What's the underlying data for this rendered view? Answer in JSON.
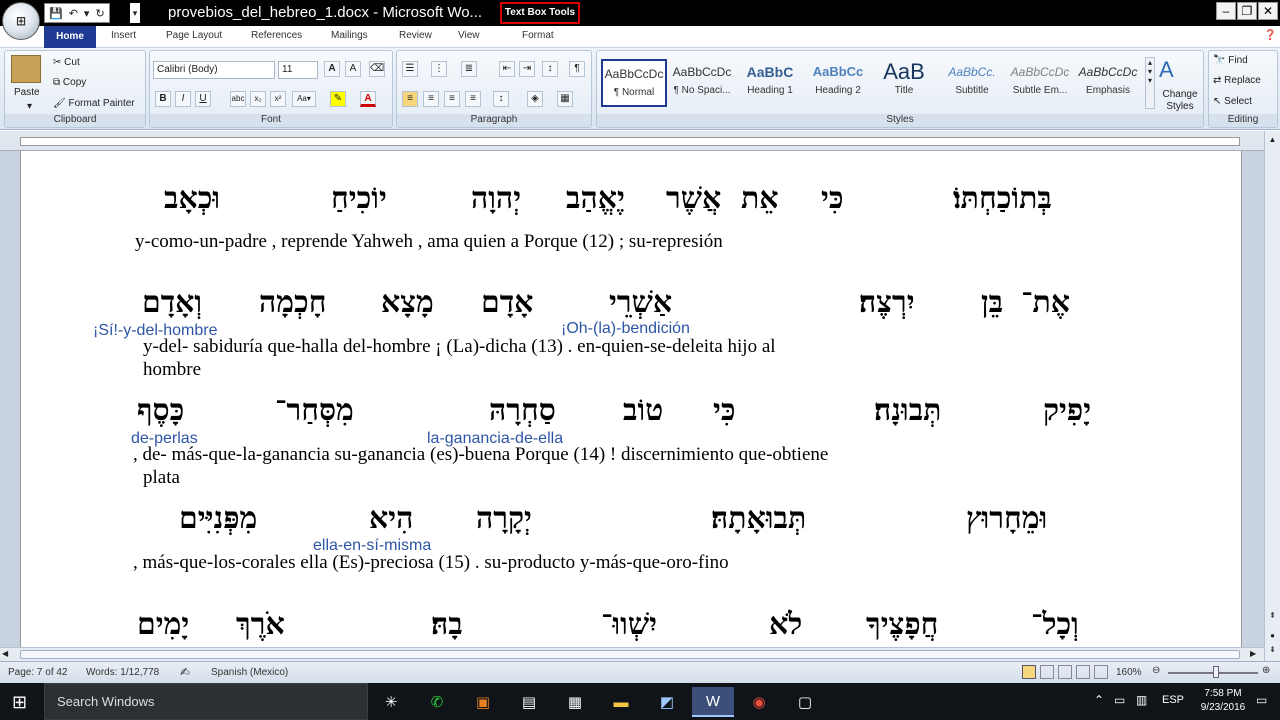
{
  "window": {
    "title": "provebios_del_hebreo_1.docx - Microsoft Wo...",
    "context_tab": "Text Box Tools",
    "office_button": "⊞"
  },
  "tabs": [
    "Home",
    "Insert",
    "Page Layout",
    "References",
    "Mailings",
    "Review",
    "View",
    "Format"
  ],
  "clipboard": {
    "paste": "Paste",
    "cut": "Cut",
    "copy": "Copy",
    "format_painter": "Format Painter",
    "label": "Clipboard"
  },
  "font": {
    "name": "Calibri (Body)",
    "size": "11",
    "label": "Font"
  },
  "paragraph": {
    "label": "Paragraph"
  },
  "styles": {
    "label": "Styles",
    "items": [
      {
        "preview": "AaBbCcDc",
        "name": "¶ Normal"
      },
      {
        "preview": "AaBbCcDc",
        "name": "¶ No Spaci..."
      },
      {
        "preview": "AaBbC",
        "name": "Heading 1"
      },
      {
        "preview": "AaBbCc",
        "name": "Heading 2"
      },
      {
        "preview": "AaB",
        "name": "Title"
      },
      {
        "preview": "AaBbCc.",
        "name": "Subtitle"
      },
      {
        "preview": "AaBbCcDc",
        "name": "Subtle Em..."
      },
      {
        "preview": "AaBbCcDc",
        "name": "Emphasis"
      }
    ],
    "change_styles": "Change Styles"
  },
  "editing": {
    "find": "Find",
    "replace": "Replace",
    "select": "Select",
    "label": "Editing"
  },
  "document": {
    "verses": [
      {
        "hebrew": [
          "בְּתוֹכַחְתּוֹ׃",
          "כִּי",
          "אֵת",
          "אֲשֶׁר",
          "יֶאֱהַב",
          "יְהוָה",
          "יוֹכִיחַ",
          "וּכְאָב"
        ],
        "spanish": "y-como-un-padre   , reprende      Yahweh     , ama       quien     a    Porque   (12)    ; su-represión",
        "comments": []
      },
      {
        "hebrew": [
          "אֶת־",
          "בֵּן",
          "יִרְצֶה׃",
          "אַשְׁרֵי",
          "אָדָם",
          "מָצָא",
          "חָכְמָה",
          "וְאָדָם"
        ],
        "spanish": "y-del-      sabiduría    que-halla   del-hombre   ¡ (La)-dicha    (13)     . en-quien-se-deleita    hijo     al",
        "spanish2": "hombre",
        "comments": [
          "¡Sí!-y-del-hombre",
          "¡Oh-(la)-bendición"
        ]
      },
      {
        "hebrew": [
          "יָפִיק",
          "תְּבוּנָה׃",
          "כִּי",
          "טוֹב",
          "סַחְרָהּ",
          "מִסְּחַר־",
          "כָּסֶף"
        ],
        "spanish": ", de-      más-que-la-ganancia      su-ganancia    (es)-buena   Porque   (14)   ! discernimiento   que-obtiene",
        "spanish2": "plata",
        "comments": [
          "de-perlas",
          "la-ganancia-de-ella"
        ]
      },
      {
        "hebrew": [
          "וּמֵחָרוּץ",
          "תְּבוּאָתָהּ׃",
          "יְקָרָה",
          "הִיא",
          "מִפְּנִיִּים"
        ],
        "spanish": ", más-que-los-corales          ella      (Es)-preciosa         (15)         . su-producto                 y-más-que-oro-fino",
        "comments": [
          "ella-en-sí-misma"
        ]
      },
      {
        "hebrew": [
          "וְכָל־",
          "חֲפָצֶיךָ",
          "לֹא",
          "יִשְׁווּ־",
          "בָהּ׃",
          "אֹרֶךְ",
          "יָמִים"
        ]
      }
    ]
  },
  "status": {
    "page": "Page: 7 of 42",
    "words": "Words: 1/12,778",
    "language": "Spanish (Mexico)",
    "zoom": "160%"
  },
  "taskbar": {
    "search": "Search Windows",
    "lang": "ESP",
    "time": "7:58 PM",
    "date": "9/23/2016"
  }
}
